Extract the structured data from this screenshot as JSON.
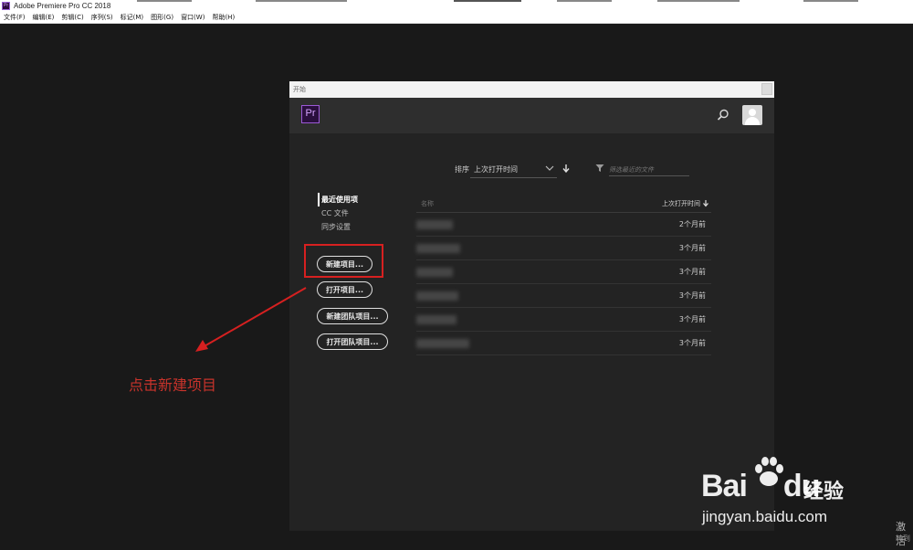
{
  "app": {
    "icon": "premiere-app-icon",
    "title": "Adobe Premiere Pro CC 2018"
  },
  "menu": [
    "文件(F)",
    "编辑(E)",
    "剪辑(C)",
    "序列(S)",
    "标记(M)",
    "图形(G)",
    "窗口(W)",
    "帮助(H)"
  ],
  "dialog": {
    "title": "开始",
    "logo": "Pr",
    "sort_label": "排序",
    "sort_value": "上次打开时间",
    "filter_placeholder": "筛选最近的文件",
    "nav": [
      "最近使用项",
      "CC 文件",
      "同步设置"
    ],
    "buttons": {
      "new_project": "新建项目...",
      "open_project": "打开项目...",
      "new_team_project": "新建团队项目...",
      "open_team_project": "打开团队项目..."
    },
    "list": {
      "name_header": "名称",
      "time_header": "上次打开时间",
      "rows": [
        {
          "time": "2个月前"
        },
        {
          "time": "3个月前"
        },
        {
          "time": "3个月前"
        },
        {
          "time": "3个月前"
        },
        {
          "time": "3个月前"
        },
        {
          "time": "3个月前"
        }
      ]
    }
  },
  "annotation": {
    "text": "点击新建项目",
    "color": "#c8332b"
  },
  "watermark": {
    "logo_left": "Bai",
    "logo_right": "du",
    "logo_cn": "经验",
    "url": "jingyan.baidu.com"
  },
  "activation": {
    "line1": "激活",
    "line2": "转到"
  }
}
